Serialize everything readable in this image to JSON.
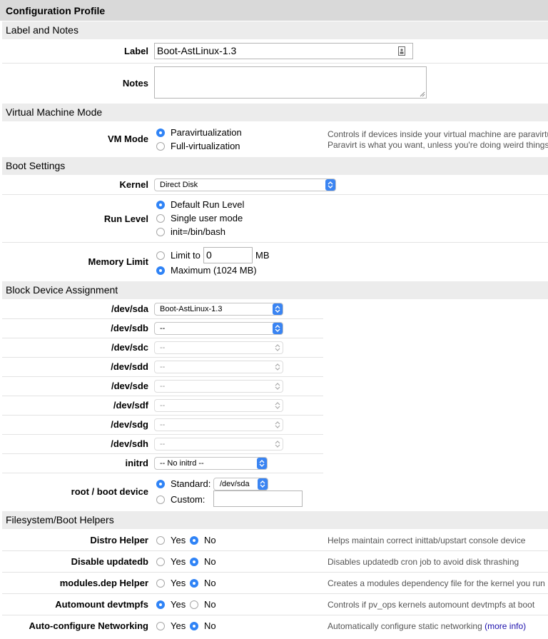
{
  "title": "Configuration Profile",
  "sections": {
    "label_notes": "Label and Notes",
    "vm_mode": "Virtual Machine Mode",
    "boot_settings": "Boot Settings",
    "block_devices": "Block Device Assignment",
    "helpers": "Filesystem/Boot Helpers"
  },
  "label_field": {
    "label": "Label",
    "value": "Boot-AstLinux-1.3"
  },
  "notes_field": {
    "label": "Notes",
    "value": ""
  },
  "vm_mode": {
    "label": "VM Mode",
    "options": [
      "Paravirtualization",
      "Full-virtualization"
    ],
    "selected": "Paravirtualization",
    "desc1": "Controls if devices inside your virtual machine are paravirtu",
    "desc2": "Paravirt is what you want, unless you're doing weird things"
  },
  "kernel": {
    "label": "Kernel",
    "value": "Direct Disk"
  },
  "run_level": {
    "label": "Run Level",
    "options": [
      "Default Run Level",
      "Single user mode",
      "init=/bin/bash"
    ],
    "selected": "Default Run Level"
  },
  "memory_limit": {
    "label": "Memory Limit",
    "limit_label": "Limit to",
    "limit_value": "0",
    "unit": "MB",
    "maximum_label": "Maximum (1024 MB)",
    "selected": "Maximum (1024 MB)"
  },
  "devices": [
    {
      "label": "/dev/sda",
      "value": "Boot-AstLinux-1.3"
    },
    {
      "label": "/dev/sdb",
      "value": "--"
    },
    {
      "label": "/dev/sdc",
      "value": "--"
    },
    {
      "label": "/dev/sdd",
      "value": "--"
    },
    {
      "label": "/dev/sde",
      "value": "--"
    },
    {
      "label": "/dev/sdf",
      "value": "--"
    },
    {
      "label": "/dev/sdg",
      "value": "--"
    },
    {
      "label": "/dev/sdh",
      "value": "--"
    }
  ],
  "initrd": {
    "label": "initrd",
    "value": "-- No initrd --"
  },
  "root_device": {
    "label": "root / boot device",
    "standard_label": "Standard:",
    "standard_value": "/dev/sda",
    "custom_label": "Custom:",
    "custom_value": "",
    "selected": "Standard:"
  },
  "helpers": [
    {
      "label": "Distro Helper",
      "yes": "Yes",
      "no": "No",
      "selected": "No",
      "desc": "Helps maintain correct inittab/upstart console device"
    },
    {
      "label": "Disable updatedb",
      "yes": "Yes",
      "no": "No",
      "selected": "No",
      "desc": "Disables updatedb cron job to avoid disk thrashing"
    },
    {
      "label": "modules.dep Helper",
      "yes": "Yes",
      "no": "No",
      "selected": "No",
      "desc": "Creates a modules dependency file for the kernel you run"
    },
    {
      "label": "Automount devtmpfs",
      "yes": "Yes",
      "no": "No",
      "selected": "Yes",
      "desc": "Controls if pv_ops kernels automount devtmpfs at boot"
    },
    {
      "label": "Auto-configure Networking",
      "yes": "Yes",
      "no": "No",
      "selected": "No",
      "desc": "Automatically configure static networking",
      "link": "(more info)"
    }
  ],
  "colors": {
    "accent": "#2f83f6",
    "section_bg": "#ececec",
    "title_bg": "#d9d9d9"
  }
}
